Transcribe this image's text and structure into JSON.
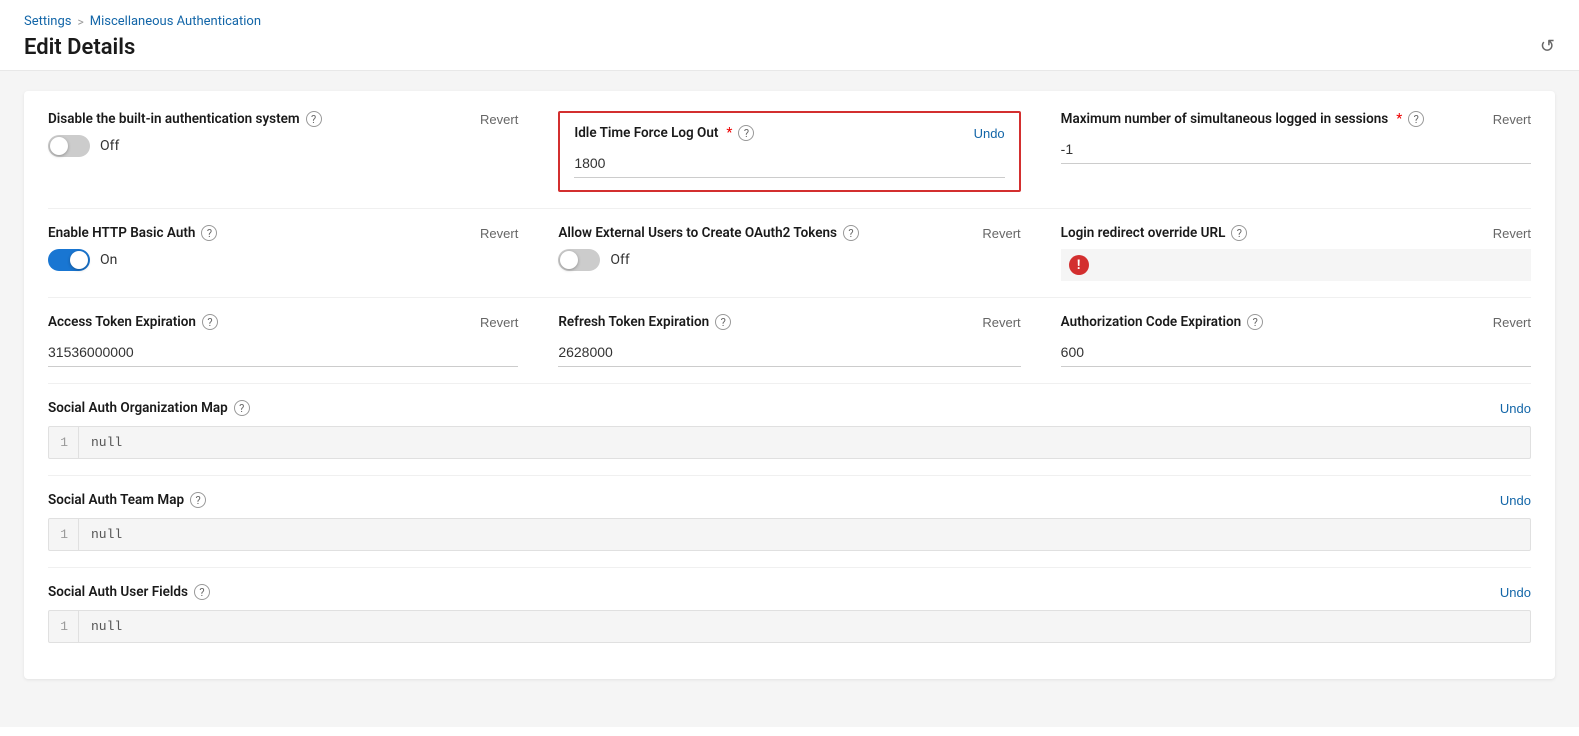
{
  "breadcrumb": {
    "settings_label": "Settings",
    "separator": ">",
    "current_label": "Miscellaneous Authentication"
  },
  "page": {
    "title": "Edit Details"
  },
  "fields": {
    "disable_builtin_auth": {
      "label": "Disable the built-in authentication system",
      "toggle_state": "off",
      "toggle_label": "Off",
      "revert_label": "Revert"
    },
    "idle_time_force_logout": {
      "label": "Idle Time Force Log Out",
      "required": "*",
      "value": "1800",
      "undo_label": "Undo"
    },
    "max_simultaneous_sessions": {
      "label": "Maximum number of simultaneous logged in sessions",
      "required": "*",
      "value": "-1",
      "revert_label": "Revert"
    },
    "enable_http_basic_auth": {
      "label": "Enable HTTP Basic Auth",
      "toggle_state": "on",
      "toggle_label": "On",
      "revert_label": "Revert"
    },
    "allow_external_users_oauth2": {
      "label": "Allow External Users to Create OAuth2 Tokens",
      "toggle_state": "off",
      "toggle_label": "Off",
      "revert_label": "Revert"
    },
    "login_redirect_url": {
      "label": "Login redirect override URL",
      "value": "",
      "revert_label": "Revert",
      "has_error": true
    },
    "access_token_expiration": {
      "label": "Access Token Expiration",
      "value": "31536000000",
      "revert_label": "Revert"
    },
    "refresh_token_expiration": {
      "label": "Refresh Token Expiration",
      "value": "2628000",
      "revert_label": "Revert"
    },
    "authorization_code_expiration": {
      "label": "Authorization Code Expiration",
      "value": "600",
      "revert_label": "Revert"
    }
  },
  "maps": {
    "social_auth_org_map": {
      "label": "Social Auth Organization Map",
      "value": "null",
      "line_number": "1",
      "undo_label": "Undo"
    },
    "social_auth_team_map": {
      "label": "Social Auth Team Map",
      "value": "null",
      "line_number": "1",
      "undo_label": "Undo"
    },
    "social_auth_user_fields": {
      "label": "Social Auth User Fields",
      "value": "null",
      "line_number": "1",
      "undo_label": "Undo"
    }
  },
  "icons": {
    "help": "?",
    "history": "↺",
    "error": "!"
  }
}
